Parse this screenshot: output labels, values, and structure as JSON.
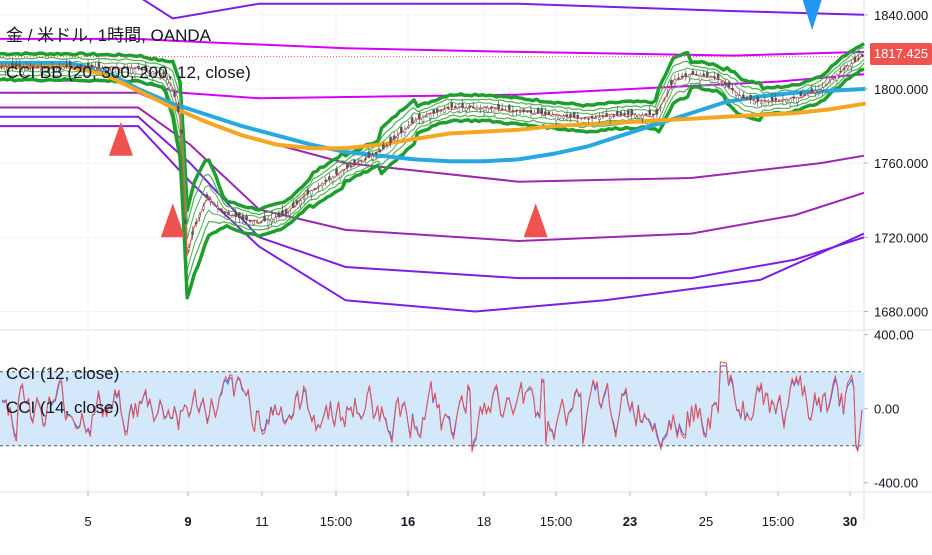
{
  "header": {
    "symbol": "金 / 米ドル, 1時間, OANDA",
    "indicator": "CCI BB (20, 300, 200, 12, close)"
  },
  "cci_panel": {
    "legend1": "CCI (12, close)",
    "legend2": "CCI (14, close)"
  },
  "last_price": "1817.425",
  "colors": {
    "green": "#1e9e2e",
    "light_green": "#4caf50",
    "purple": "#9c27b0",
    "violet": "#7b1fe0",
    "magenta": "#d500f9",
    "blue": "#29a8e0",
    "orange": "#f5a623",
    "red_triangle": "#ef5350",
    "blue_triangle": "#2196f3",
    "cci_band_fill": "#d4e8fb"
  },
  "chart_data": [
    {
      "type": "line",
      "title": "金 / 米ドル, 1時間, OANDA",
      "x_ticks": [
        "5",
        "9",
        "11",
        "15:00",
        "16",
        "18",
        "15:00",
        "23",
        "25",
        "15:00",
        "30"
      ],
      "y_ticks": [
        "1840.000",
        "1800.000",
        "1760.000",
        "1720.000",
        "1680.000"
      ],
      "ylim": [
        1670,
        1848
      ],
      "current_price": 1817.425,
      "series": [
        {
          "name": "",
          "color": "#29a8e0",
          "x": [
            0,
            8,
            12,
            16,
            20,
            24,
            28,
            32,
            36,
            40,
            44,
            48,
            52,
            56,
            60,
            64,
            68,
            72,
            76,
            80,
            84,
            88,
            92,
            96,
            100
          ],
          "values": [
            1814,
            1814,
            1810,
            1800,
            1792,
            1786,
            1780,
            1775,
            1770,
            1766,
            1764,
            1762,
            1761,
            1761,
            1762,
            1765,
            1769,
            1775,
            1781,
            1787,
            1793,
            1796,
            1798,
            1799,
            1800
          ]
        },
        {
          "name": "",
          "color": "#f5a623",
          "x": [
            0,
            8,
            12,
            16,
            20,
            24,
            28,
            32,
            36,
            40,
            44,
            48,
            52,
            56,
            60,
            64,
            68,
            72,
            76,
            80,
            84,
            88,
            92,
            96,
            100
          ],
          "values": [
            1812,
            1812,
            1808,
            1799,
            1790,
            1782,
            1775,
            1770,
            1768,
            1768,
            1770,
            1773,
            1776,
            1777,
            1778,
            1780,
            1781,
            1782,
            1783,
            1784,
            1785,
            1786,
            1787,
            1789,
            1792
          ]
        }
      ],
      "markers": [
        {
          "type": "up",
          "x": 14,
          "y": 1764
        },
        {
          "type": "up",
          "x": 20,
          "y": 1720
        },
        {
          "type": "up",
          "x": 62,
          "y": 1720
        },
        {
          "type": "down",
          "x": 94,
          "y": 1849
        }
      ]
    },
    {
      "type": "line",
      "title": "CCI (12, close)",
      "y_ticks": [
        "400.00",
        "0.00",
        "-400.00"
      ],
      "ylim": [
        -450,
        420
      ],
      "band": [
        -200,
        200
      ]
    }
  ]
}
